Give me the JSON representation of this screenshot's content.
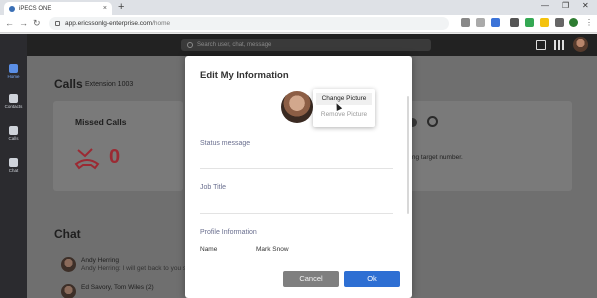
{
  "browser": {
    "tab_title": "iPECS ONE",
    "tab_close": "×",
    "new_tab": "+",
    "url_host": "app.ericssonlg-enterprise.com",
    "url_path": "/home",
    "window_controls": [
      "—",
      "❐",
      "✕"
    ]
  },
  "sidebar": {
    "items": [
      {
        "label": "Home",
        "icon": "home-icon",
        "active": true
      },
      {
        "label": "Contacts",
        "icon": "contacts-icon",
        "active": false
      },
      {
        "label": "Calls",
        "icon": "phone-icon",
        "active": false
      },
      {
        "label": "Chat",
        "icon": "chat-icon",
        "active": false
      }
    ]
  },
  "topbar": {
    "search_placeholder": "Search user, chat, message"
  },
  "main": {
    "calls_title": "Calls",
    "extension": "Extension 1003",
    "missed_title": "Missed Calls",
    "missed_count": "0",
    "partial_text_1": "e.",
    "partial_text_2": "ming target number.",
    "chat_title": "Chat",
    "chat_items": [
      {
        "name": "Andy Herring",
        "message": "Andy Herring: I will get back to you sh"
      },
      {
        "name": "Ed Savory, Tom Wiles (2)",
        "message": ""
      }
    ]
  },
  "modal": {
    "title": "Edit My Information",
    "change_picture": "Change Picture",
    "remove_picture": "Remove Picture",
    "status_label": "Status message",
    "job_label": "Job Title",
    "section_label": "Profile Information",
    "name_label": "Name",
    "name_value": "Mark Snow",
    "cancel_label": "Cancel",
    "ok_label": "Ok"
  },
  "colors": {
    "accent": "#2e6fd3",
    "missed": "#9b2a33",
    "sidebar_bg": "#2b2b2f"
  }
}
